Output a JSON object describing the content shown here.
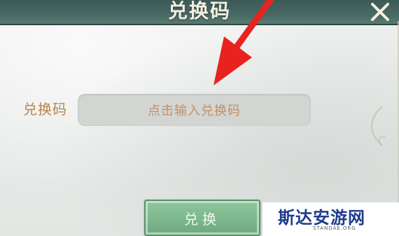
{
  "dialog": {
    "title": "兑换码",
    "close_icon": "close-icon"
  },
  "form": {
    "label": "兑换码",
    "input_placeholder": "点击输入兑换码",
    "input_value": ""
  },
  "actions": {
    "redeem_label": "兑换"
  },
  "overlay": {
    "arrow_icon": "red-arrow-pointer",
    "arrow_color": "#e8231f"
  },
  "watermark": {
    "brand": "斯达安游网",
    "sub": "STANDAE.ORG"
  },
  "colors": {
    "title_bar": "#3c5a55",
    "label": "#b9834f",
    "button": "#7fb98d"
  }
}
